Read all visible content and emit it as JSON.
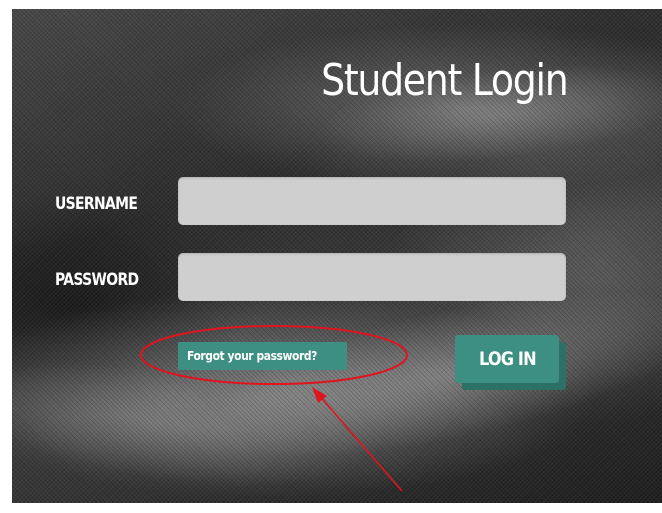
{
  "page": {
    "title": "Student Login"
  },
  "form": {
    "username_label": "USERNAME",
    "username_value": "",
    "password_label": "PASSWORD",
    "password_value": "",
    "forgot_link": "Forgot your password?",
    "login_button": "LOG IN"
  },
  "colors": {
    "accent": "#3d9081",
    "accent_shadow": "#2d7064",
    "field_bg": "#cfcfcf",
    "annotation": "#e0141e"
  }
}
